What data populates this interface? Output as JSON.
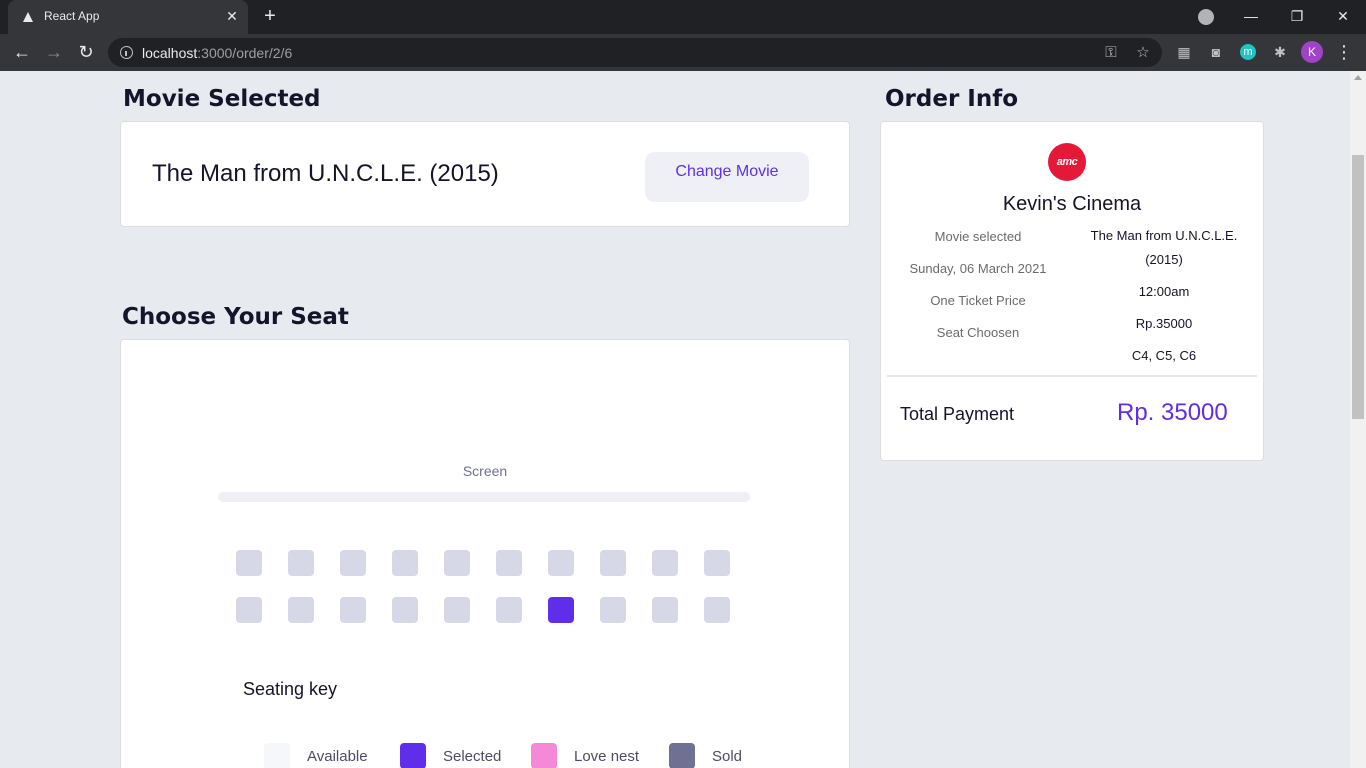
{
  "browser": {
    "tab_title": "React App",
    "tab_close": "✕",
    "new_tab": "+",
    "url_host": "localhost",
    "url_path": ":3000/order/2/6",
    "minimize": "—",
    "restore": "❐",
    "close": "✕",
    "back": "←",
    "forward": "→",
    "reload": "↻",
    "extension_m": "m",
    "profile_initial": "K",
    "menu": "⋮"
  },
  "movie_section": {
    "title": "Movie Selected",
    "movie_name": "The Man from U.N.C.L.E. (2015)",
    "change_button": "Change Movie"
  },
  "seat_section": {
    "title": "Choose Your Seat",
    "screen_label": "Screen",
    "rows": [
      [
        "available",
        "available",
        "available",
        "available",
        "available",
        "available",
        "available",
        "available",
        "available",
        "available"
      ],
      [
        "available",
        "available",
        "available",
        "available",
        "available",
        "available",
        "selected",
        "available",
        "available",
        "available"
      ]
    ],
    "seating_key_title": "Seating key",
    "seating_key": [
      {
        "label": "Available",
        "color": "#f6f7fb"
      },
      {
        "label": "Selected",
        "color": "#5f2eea"
      },
      {
        "label": "Love nest",
        "color": "#f589d7"
      },
      {
        "label": "Sold",
        "color": "#6e7191"
      }
    ]
  },
  "order_info": {
    "title": "Order Info",
    "logo_text": "amc",
    "cinema_name": "Kevin's Cinema",
    "labels": [
      "Movie selected",
      "Sunday, 06 March 2021",
      "One Ticket Price",
      "Seat Choosen"
    ],
    "values": [
      "The Man from U.N.C.L.E. (2015)",
      "12:00am",
      "Rp.35000",
      "C4, C5, C6"
    ],
    "total_label": "Total Payment",
    "total_value": "Rp. 35000"
  },
  "colors": {
    "accent": "#5f2eea",
    "seat_available": "#d6d8e7",
    "background": "#e7eaee"
  }
}
